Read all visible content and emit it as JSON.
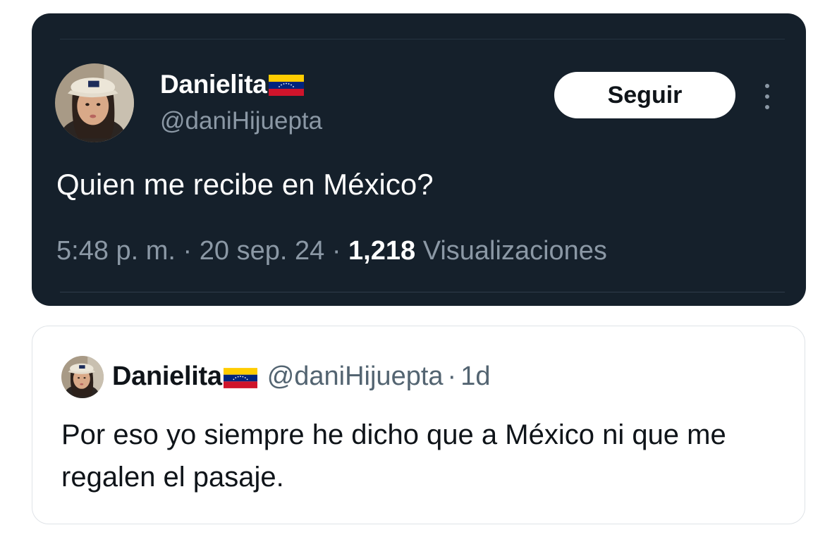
{
  "tweet": {
    "author_name": "Danielita",
    "author_handle": "@daniHijuepta",
    "follow_label": "Seguir",
    "text": "Quien me recibe en México?",
    "time": "5:48 p. m.",
    "separator": "·",
    "date": "20 sep. 24",
    "views_count": "1,218",
    "views_label": "Visualizaciones",
    "flag_icon": "venezuela-flag-icon"
  },
  "quoted_tweet": {
    "author_name": "Danielita",
    "author_handle": "@daniHijuepta",
    "separator": "·",
    "relative_time": "1d",
    "text": "Por eso yo siempre he dicho que a México ni que me regalen el pasaje."
  },
  "colors": {
    "dark_card_bg": "#15202b",
    "secondary_text_dark": "#8b98a5",
    "secondary_text_light": "#536471",
    "primary_text_light": "#0f1419",
    "flag_yellow": "#ffcc00",
    "flag_blue": "#00247d",
    "flag_red": "#cf142b"
  }
}
